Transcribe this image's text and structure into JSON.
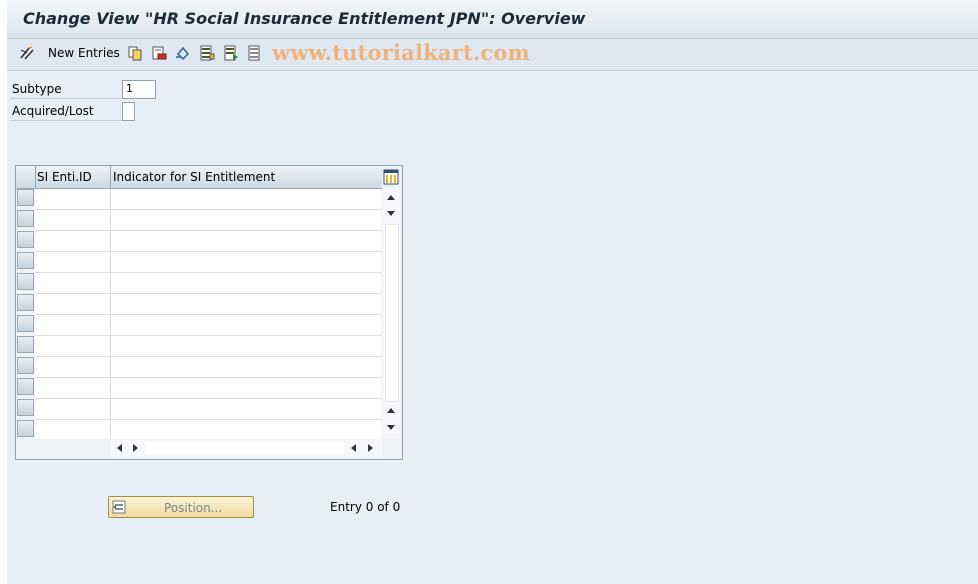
{
  "window": {
    "title": "Change View \"HR Social Insurance Entitlement JPN\": Overview"
  },
  "toolbar": {
    "new_entries_label": "New Entries",
    "watermark": "www.tutorialkart.com",
    "icons": [
      "edit-glasses-icon",
      "copy-icon",
      "delete-icon",
      "undo-icon",
      "select-all-icon",
      "select-block-icon",
      "deselect-all-icon"
    ]
  },
  "fields": {
    "subtype_label": "Subtype",
    "subtype_value": "1",
    "acquired_lost_label": "Acquired/Lost",
    "acquired_lost_value": ""
  },
  "table": {
    "columns": [
      "SI Enti.ID",
      "Indicator for SI Entitlement"
    ],
    "row_count": 12,
    "rows": []
  },
  "footer": {
    "position_button_label": "Position...",
    "entry_text": "Entry 0 of 0"
  },
  "colors": {
    "background": "#e7eef5",
    "button_bg": "#f0dca0",
    "watermark": "#efb37a"
  }
}
